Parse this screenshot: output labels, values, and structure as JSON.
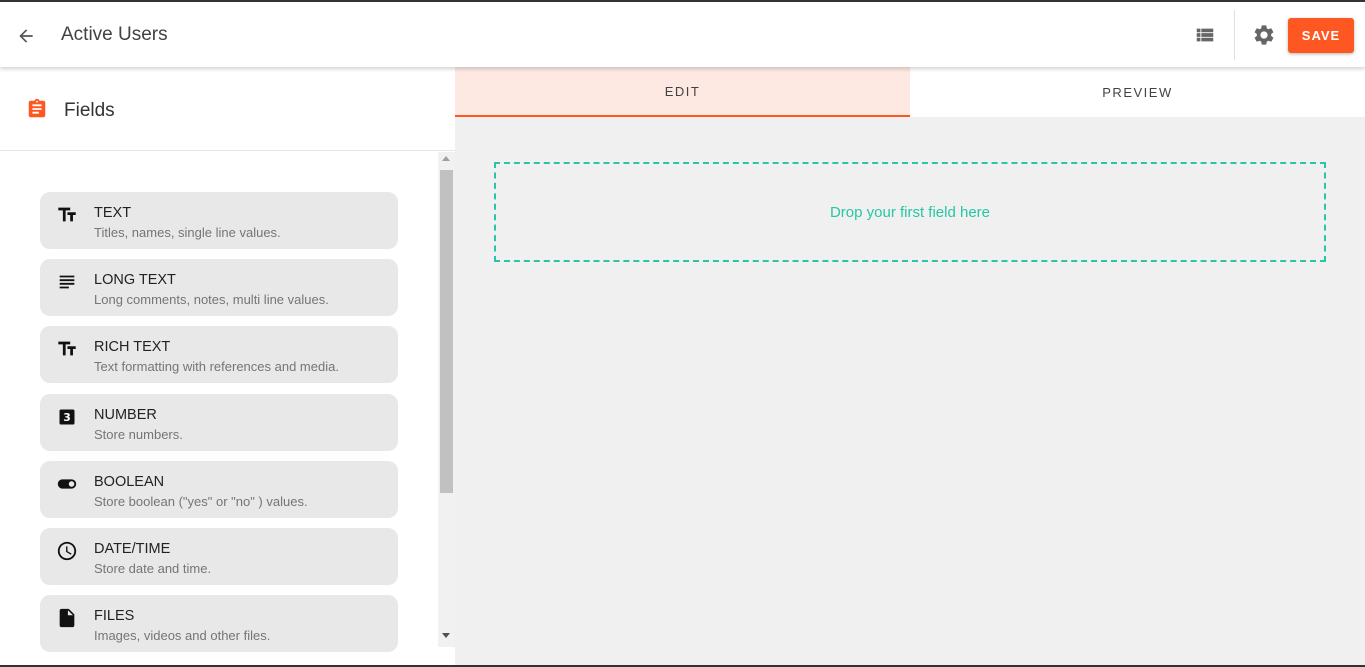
{
  "header": {
    "title": "Active Users",
    "save_label": "SAVE",
    "back_icon": "arrow-back-icon",
    "list_icon": "view-list-icon",
    "settings_icon": "gear-icon",
    "accent_color": "#ff5722"
  },
  "sidebar": {
    "title": "Fields",
    "icon": "clipboard-icon",
    "items": [
      {
        "name": "TEXT",
        "desc": "Titles, names, single line values.",
        "icon": "text-format-icon"
      },
      {
        "name": "LONG TEXT",
        "desc": "Long comments, notes, multi line values.",
        "icon": "long-text-icon"
      },
      {
        "name": "RICH TEXT",
        "desc": "Text formatting with references and media.",
        "icon": "text-format-icon"
      },
      {
        "name": "NUMBER",
        "desc": "Store numbers.",
        "icon": "number-icon"
      },
      {
        "name": "BOOLEAN",
        "desc": "Store boolean (\"yes\" or \"no\" ) values.",
        "icon": "toggle-icon"
      },
      {
        "name": "DATE/TIME",
        "desc": "Store date and time.",
        "icon": "clock-icon"
      },
      {
        "name": "FILES",
        "desc": "Images, videos and other files.",
        "icon": "file-icon"
      }
    ]
  },
  "tabs": [
    {
      "label": "EDIT",
      "active": true
    },
    {
      "label": "PREVIEW",
      "active": false
    }
  ],
  "canvas": {
    "drop_text": "Drop your first field here",
    "drop_color": "#26c6a6"
  }
}
